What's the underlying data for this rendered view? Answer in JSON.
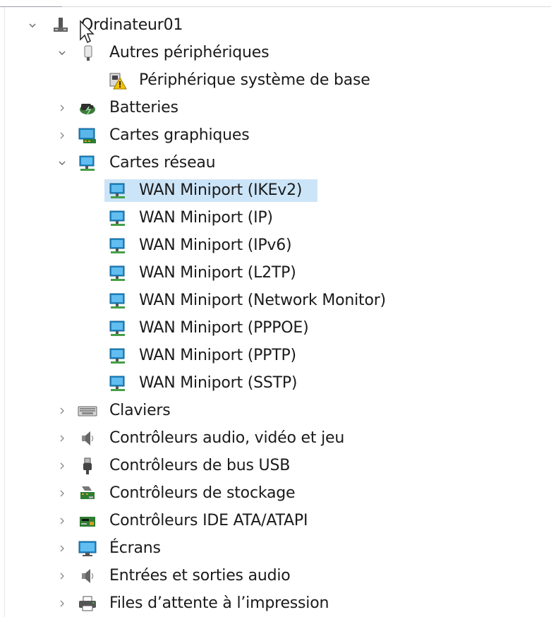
{
  "tree": {
    "root": {
      "label": "Ordinateur01",
      "icon": "computer-icon",
      "expanded": true
    },
    "items": [
      {
        "label": "Autres périphériques",
        "icon": "unknown-device-icon",
        "expanded": true
      },
      {
        "label": "Périphérique système de base",
        "icon": "warning-device-icon"
      },
      {
        "label": "Batteries",
        "icon": "battery-icon",
        "expanded": false
      },
      {
        "label": "Cartes graphiques",
        "icon": "display-adapter-icon",
        "expanded": false
      },
      {
        "label": "Cartes réseau",
        "icon": "network-adapter-icon",
        "expanded": true
      },
      {
        "label": "WAN Miniport (IKEv2)",
        "icon": "network-adapter-icon",
        "selected": true
      },
      {
        "label": "WAN Miniport (IP)",
        "icon": "network-adapter-icon"
      },
      {
        "label": "WAN Miniport (IPv6)",
        "icon": "network-adapter-icon"
      },
      {
        "label": "WAN Miniport (L2TP)",
        "icon": "network-adapter-icon"
      },
      {
        "label": "WAN Miniport (Network Monitor)",
        "icon": "network-adapter-icon"
      },
      {
        "label": "WAN Miniport (PPPOE)",
        "icon": "network-adapter-icon"
      },
      {
        "label": "WAN Miniport (PPTP)",
        "icon": "network-adapter-icon"
      },
      {
        "label": "WAN Miniport (SSTP)",
        "icon": "network-adapter-icon"
      },
      {
        "label": "Claviers",
        "icon": "keyboard-icon",
        "expanded": false
      },
      {
        "label": "Contrôleurs audio, vidéo et jeu",
        "icon": "speaker-icon",
        "expanded": false
      },
      {
        "label": "Contrôleurs de bus USB",
        "icon": "usb-icon",
        "expanded": false
      },
      {
        "label": "Contrôleurs de stockage",
        "icon": "storage-controller-icon",
        "expanded": false
      },
      {
        "label": "Contrôleurs IDE ATA/ATAPI",
        "icon": "ide-controller-icon",
        "expanded": false
      },
      {
        "label": "Écrans",
        "icon": "monitor-icon",
        "expanded": false
      },
      {
        "label": "Entrées et sorties audio",
        "icon": "speaker-icon",
        "expanded": false
      },
      {
        "label": "Files d’attente à l’impression",
        "icon": "printer-icon",
        "expanded": false
      }
    ]
  },
  "colors": {
    "selection": "#cce4f7",
    "text": "#1a1a1a",
    "chevron": "#666666",
    "network_blue": "#1e88c8",
    "network_green": "#46a046"
  }
}
